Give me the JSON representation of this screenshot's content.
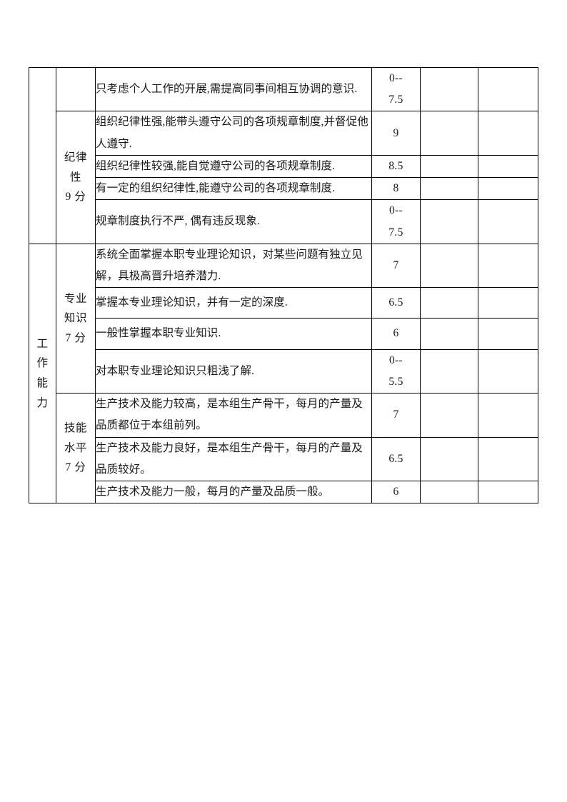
{
  "document": {
    "type": "performance-evaluation-table",
    "columns": {
      "category": "",
      "subcategory": "",
      "description": "",
      "standard_score": "",
      "self_score": "",
      "manager_score": ""
    }
  },
  "table": {
    "rows": [
      {
        "category": "",
        "subcategory": "",
        "description": "只考虑个人工作的开展,需提高同事间相互协调的意识.",
        "score_lines": [
          "0--",
          "7.5"
        ],
        "self": "",
        "manager": ""
      },
      {
        "category": "",
        "subcategory": "",
        "description": "组织纪律性强,能带头遵守公司的各项规章制度,并督促他人遵守.",
        "score_lines": [
          "9"
        ],
        "self": "",
        "manager": ""
      },
      {
        "category": "",
        "subcategory": "",
        "description": "组织纪律性较强,能自觉遵守公司的各项规章制度.",
        "score_lines": [
          "8.5"
        ],
        "self": "",
        "manager": ""
      },
      {
        "category": "",
        "subcategory": "",
        "description": "有一定的组织纪律性,能遵守公司的各项规章制度.",
        "score_lines": [
          "8"
        ],
        "self": "",
        "manager": ""
      },
      {
        "category": "",
        "subcategory": "",
        "description": "规章制度执行不严, 偶有违反现象.",
        "score_lines": [
          "0--",
          "7.5"
        ],
        "self": "",
        "manager": ""
      },
      {
        "category": "",
        "subcategory": "",
        "description": "系统全面掌握本职专业理论知识，对某些问题有独立见解，具极高晋升培养潜力.",
        "score_lines": [
          "7"
        ],
        "self": "",
        "manager": ""
      },
      {
        "category": "",
        "subcategory": "",
        "description": "掌握本专业理论知识，并有一定的深度.",
        "score_lines": [
          "6.5"
        ],
        "self": "",
        "manager": ""
      },
      {
        "category": "",
        "subcategory": "",
        "description": "一般性掌握本职专业知识.",
        "score_lines": [
          "6"
        ],
        "self": "",
        "manager": ""
      },
      {
        "category": "",
        "subcategory": "",
        "description": "对本职专业理论知识只粗浅了解.",
        "score_lines": [
          "0--",
          "5.5"
        ],
        "self": "",
        "manager": ""
      },
      {
        "category": "",
        "subcategory": "",
        "description": "生产技术及能力较高，是本组生产骨干，每月的产量及品质都位于本组前列。",
        "score_lines": [
          "7"
        ],
        "self": "",
        "manager": ""
      },
      {
        "category": "",
        "subcategory": "",
        "description": "生产技术及能力良好，是本组生产骨干，每月的产量及品质较好。",
        "score_lines": [
          "6.5"
        ],
        "self": "",
        "manager": ""
      },
      {
        "category": "",
        "subcategory": "",
        "description": "生产技术及能力一般，每月的产量及品质一般。",
        "score_lines": [
          "6"
        ],
        "self": "",
        "manager": ""
      }
    ],
    "category_labels": {
      "work_ability": [
        "工",
        "作",
        "能",
        "力"
      ]
    },
    "subcategory_labels": {
      "discipline": [
        "纪律",
        "性",
        "9 分"
      ],
      "professional_knowledge": [
        "专业",
        "知识",
        "7 分"
      ],
      "skill_level": [
        "技能",
        "水平",
        "7 分"
      ]
    }
  }
}
